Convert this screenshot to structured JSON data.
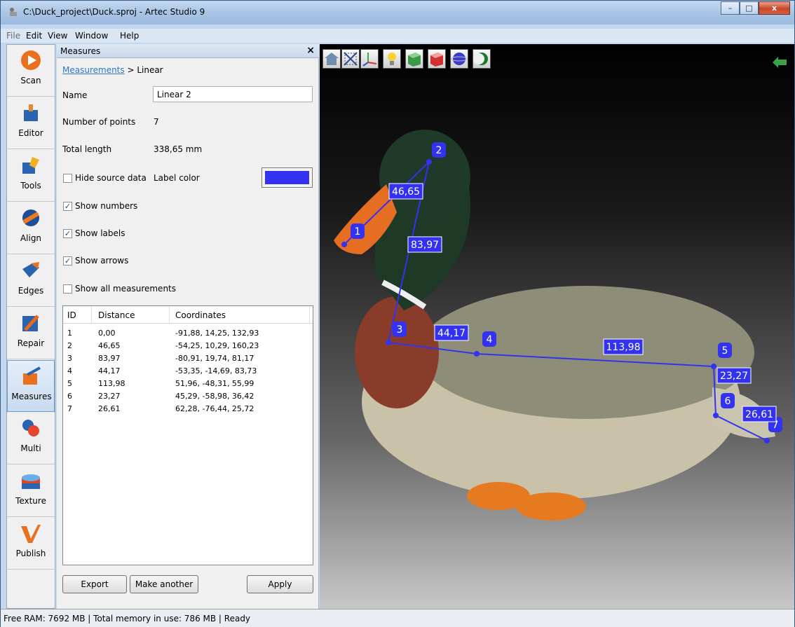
{
  "window": {
    "title": "C:\\Duck_project\\Duck.sproj - Artec Studio 9",
    "min_label": "–",
    "max_label": "□",
    "close_label": "x"
  },
  "menu": {
    "file": "File",
    "edit": "Edit",
    "view": "View",
    "window": "Window",
    "help": "Help"
  },
  "sidebar": {
    "items": [
      {
        "label": "Scan",
        "icon": "scan-icon"
      },
      {
        "label": "Editor",
        "icon": "editor-icon"
      },
      {
        "label": "Tools",
        "icon": "tools-icon"
      },
      {
        "label": "Align",
        "icon": "align-icon"
      },
      {
        "label": "Edges",
        "icon": "edges-icon"
      },
      {
        "label": "Repair",
        "icon": "repair-icon"
      },
      {
        "label": "Measures",
        "icon": "measures-icon"
      },
      {
        "label": "Multi",
        "icon": "multi-icon"
      },
      {
        "label": "Texture",
        "icon": "texture-icon"
      },
      {
        "label": "Publish",
        "icon": "publish-icon"
      }
    ],
    "active": "Measures"
  },
  "panel": {
    "title": "Measures",
    "close": "×",
    "breadcrumb_link": "Measurements",
    "breadcrumb_rest": " > Linear",
    "name_label": "Name",
    "name_value": "Linear 2",
    "points_label": "Number of points",
    "points_value": "7",
    "length_label": "Total length",
    "length_value": "338,65 mm",
    "hide_source": "Hide source data",
    "label_color": "Label color",
    "label_color_value": "#3232f0",
    "show_numbers": "Show numbers",
    "show_labels": "Show labels",
    "show_arrows": "Show arrows",
    "show_all": "Show all measurements",
    "checks": {
      "hide_source": false,
      "show_numbers": true,
      "show_labels": true,
      "show_arrows": true,
      "show_all": false
    },
    "check_mark": "✓"
  },
  "table": {
    "headers": [
      "ID",
      "Distance",
      "Coordinates"
    ],
    "rows": [
      [
        "1",
        "0,00",
        "-91,88, 14,25, 132,93"
      ],
      [
        "2",
        "46,65",
        "-54,25, 10,29, 160,23"
      ],
      [
        "3",
        "83,97",
        "-80,91, 19,74, 81,17"
      ],
      [
        "4",
        "44,17",
        "-53,35, -14,69, 83,73"
      ],
      [
        "5",
        "113,98",
        "51,96, -48,31, 55,99"
      ],
      [
        "6",
        "23,27",
        "45,29, -58,98, 36,42"
      ],
      [
        "7",
        "26,61",
        "62,28, -76,44, 25,72"
      ]
    ]
  },
  "buttons": {
    "export": "Export",
    "make_another": "Make another",
    "apply": "Apply"
  },
  "viewport": {
    "toolbar_icons": [
      "home-view-icon",
      "fit-view-icon",
      "axes-icon",
      "light-icon",
      "texture-mode-icon",
      "solid-mode-icon",
      "sphere-mode-icon",
      "moon-mode-icon"
    ],
    "points": [
      "1",
      "2",
      "3",
      "4",
      "5",
      "6",
      "7"
    ],
    "distances": [
      "46,65",
      "83,97",
      "44,17",
      "113,98",
      "23,27",
      "26,61"
    ],
    "measure_color": "#3232f0"
  },
  "status": {
    "text": "Free RAM: 7692 MB  |  Total memory in use: 786 MB  |    Ready"
  }
}
